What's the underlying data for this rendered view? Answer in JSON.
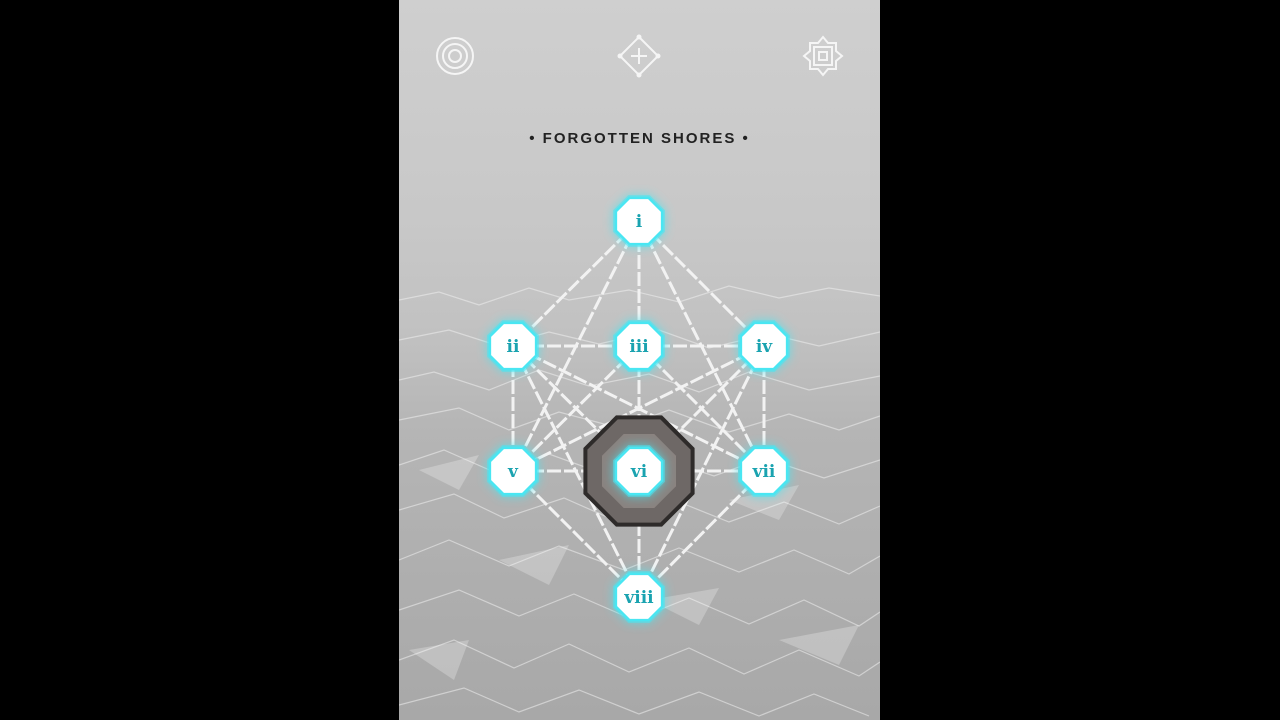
{
  "level": {
    "title": "FORGOTTEN SHORES",
    "title_bullet": "•"
  },
  "top_bar": {
    "left_icon": "concentric-rings-icon",
    "center_icon": "diamond-cross-icon",
    "right_icon": "octagon-square-icon"
  },
  "nodes": [
    {
      "id": "i",
      "label": "i",
      "state": "active"
    },
    {
      "id": "ii",
      "label": "ii",
      "state": "active"
    },
    {
      "id": "iii",
      "label": "iii",
      "state": "active"
    },
    {
      "id": "iv",
      "label": "iv",
      "state": "active"
    },
    {
      "id": "v",
      "label": "v",
      "state": "active"
    },
    {
      "id": "vi",
      "label": "vi",
      "state": "selected"
    },
    {
      "id": "vii",
      "label": "vii",
      "state": "active"
    },
    {
      "id": "viii",
      "label": "viii",
      "state": "active"
    }
  ],
  "colors": {
    "node_fill": "#ffffff",
    "node_glow": "#49e6f2",
    "node_text": "#1aa3b0",
    "line": "#f2f2f2",
    "selected_ring": "#6e6866"
  }
}
